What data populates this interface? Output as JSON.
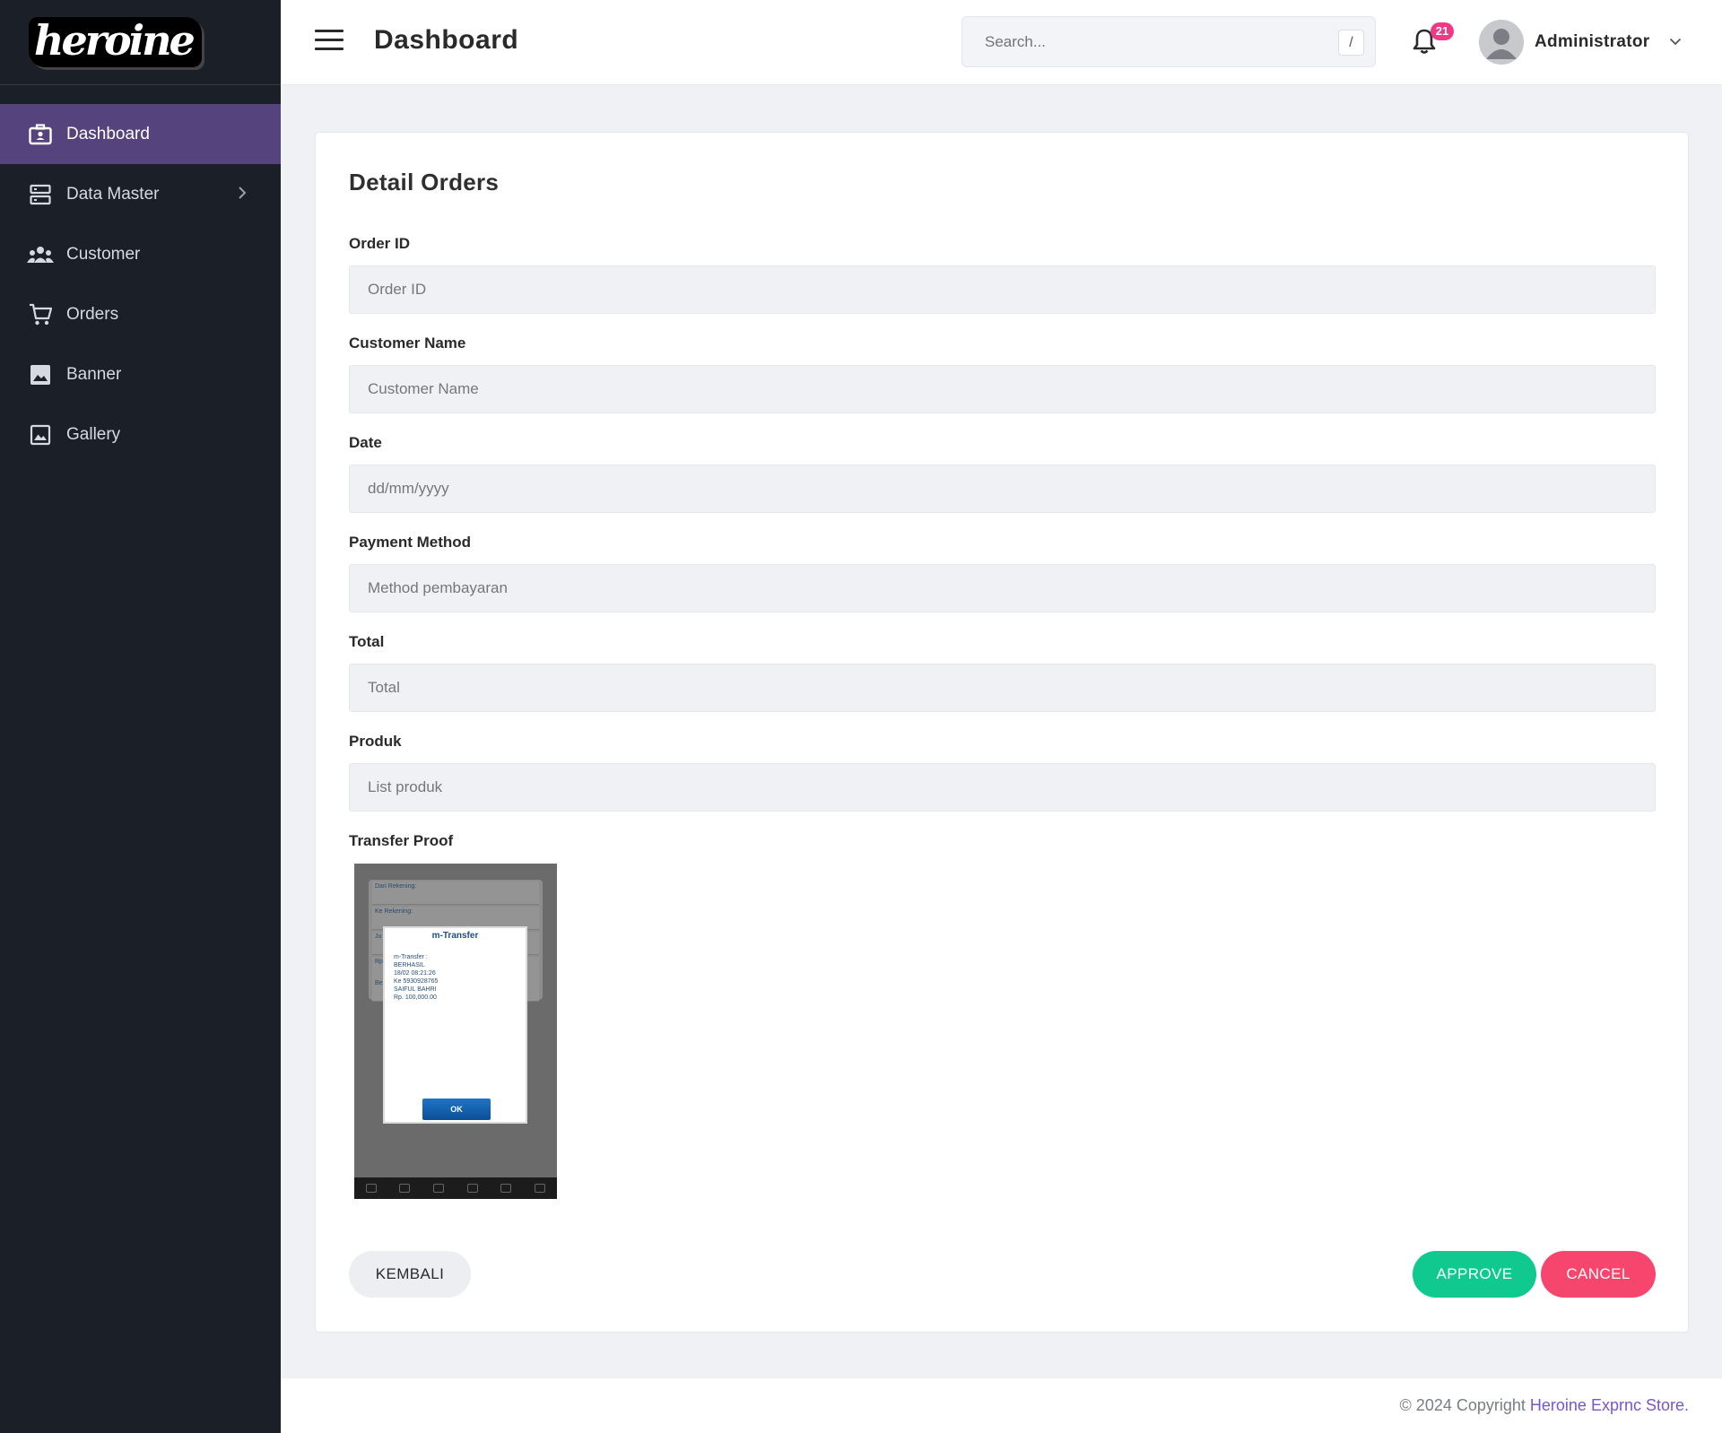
{
  "brand": {
    "logo_text": "heroine"
  },
  "sidebar": {
    "items": [
      {
        "label": "Dashboard",
        "icon": "dashboard-icon",
        "active": true
      },
      {
        "label": "Data Master",
        "icon": "server-icon",
        "has_submenu": true
      },
      {
        "label": "Customer",
        "icon": "people-icon"
      },
      {
        "label": "Orders",
        "icon": "cart-icon"
      },
      {
        "label": "Banner",
        "icon": "image-icon"
      },
      {
        "label": "Gallery",
        "icon": "gallery-icon"
      }
    ]
  },
  "header": {
    "title": "Dashboard",
    "search_placeholder": "Search...",
    "search_shortcut": "/",
    "notification_count": "21",
    "user_name": "Administrator"
  },
  "form": {
    "title": "Detail Orders",
    "fields": [
      {
        "label": "Order ID",
        "placeholder": "Order ID",
        "type": "text"
      },
      {
        "label": "Customer Name",
        "placeholder": "Customer Name",
        "type": "text"
      },
      {
        "label": "Date",
        "placeholder": "dd/mm/yyyy",
        "type": "text"
      },
      {
        "label": "Payment Method",
        "placeholder": "Method pembayaran",
        "type": "text"
      },
      {
        "label": "Total",
        "placeholder": "Total",
        "type": "text"
      },
      {
        "label": "Produk",
        "placeholder": "List produk",
        "type": "text"
      }
    ],
    "transfer_proof_label": "Transfer Proof",
    "transfer_proof": {
      "rows": [
        "Dari Rekening:",
        "Ke Rekening:",
        "Ju",
        "Rp",
        "Be"
      ],
      "dialog_title": "m-Transfer",
      "dialog_body": "m-Transfer :\nBERHASIL\n18/02 08:21:26\nKe 5930928765\nSAIFUL BAHRI\nRp. 100,000.00",
      "ok_label": "OK"
    },
    "buttons": {
      "back": "KEMBALI",
      "approve": "APPROVE",
      "cancel": "CANCEL"
    }
  },
  "footer": {
    "prefix": "© 2024 Copyright ",
    "brand": "Heroine Exprnc Store."
  },
  "colors": {
    "sidebar_bg": "#1b1f27",
    "active_nav": "#55437d",
    "approve": "#0fc98e",
    "cancel": "#f6466e",
    "badge": "#ee3a86",
    "footer_brand": "#7a55c8"
  }
}
